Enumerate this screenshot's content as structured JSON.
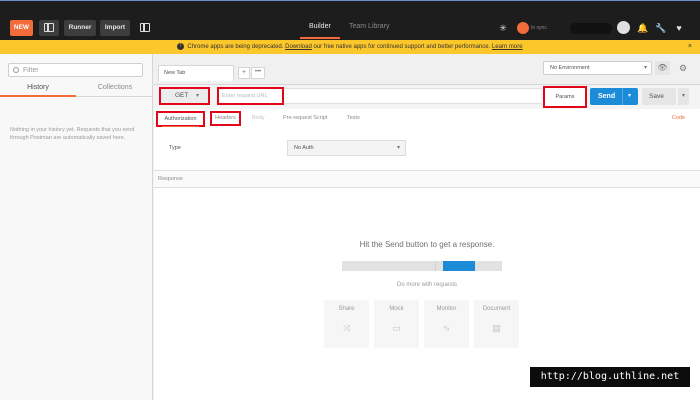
{
  "topbar": {
    "new_label": "NEW",
    "runner_label": "Runner",
    "import_label": "Import",
    "tabs": [
      {
        "label": "Builder",
        "active": true
      },
      {
        "label": "Team Library",
        "active": false
      }
    ],
    "sync_label": "In sync"
  },
  "banner": {
    "text_before": "Chrome apps are being deprecated.",
    "link_download": "Download",
    "text_middle": "our free native apps for continued support and better performance.",
    "link_learn": "Learn more",
    "close": "×"
  },
  "sidebar": {
    "search_placeholder": "Filter",
    "tabs": [
      {
        "label": "History",
        "active": true
      },
      {
        "label": "Collections",
        "active": false
      }
    ],
    "empty_message": "Nothing in your history yet. Requests that you send through Postman are automatically saved here."
  },
  "request": {
    "tab_label": "New Tab",
    "add_tab": "+",
    "more_tabs": "•••",
    "environment": "No Environment",
    "method": "GET",
    "url_placeholder": "Enter request URL",
    "params_label": "Params",
    "send_label": "Send",
    "save_label": "Save",
    "subtabs": [
      "Authorization",
      "Headers",
      "Body",
      "Pre-request Script",
      "Tests"
    ],
    "code_label": "Code",
    "auth_type_label": "Type",
    "auth_type_value": "No Auth"
  },
  "response": {
    "label": "Response",
    "hint": "Hit the Send button to get a response.",
    "more_label": "Do more with requests",
    "cards": [
      {
        "label": "Share",
        "icon": "share-icon"
      },
      {
        "label": "Mock",
        "icon": "mock-icon"
      },
      {
        "label": "Monitor",
        "icon": "monitor-icon"
      },
      {
        "label": "Document",
        "icon": "document-icon"
      }
    ]
  },
  "watermark": "http://blog.uthline.net",
  "colors": {
    "accent": "#f26b3a",
    "send_blue": "#1d8cd8",
    "banner_yellow": "#fcc72b",
    "highlight_red": "#e3061b",
    "topbar_dark": "#1d1d1d"
  }
}
